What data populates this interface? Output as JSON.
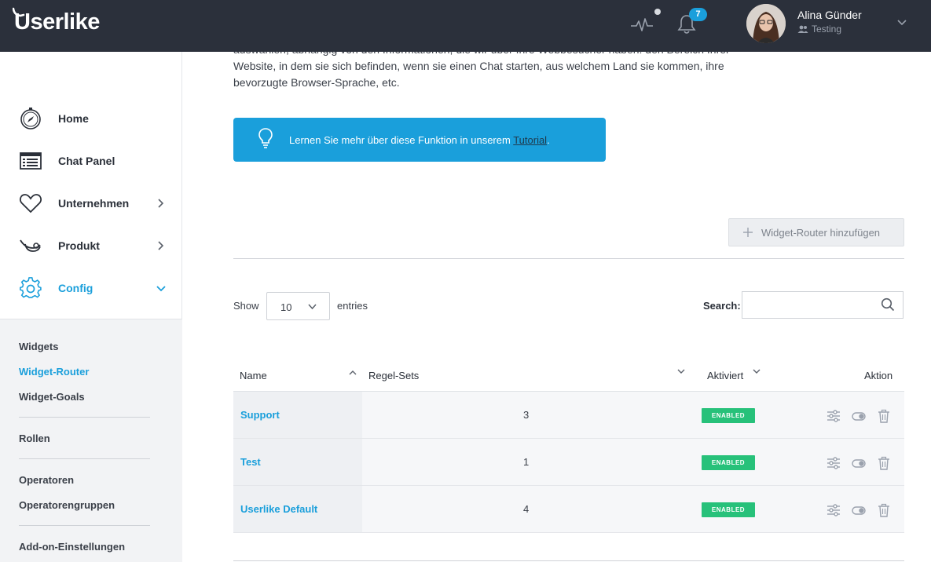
{
  "header": {
    "logo": "Userlike",
    "notifications_count": "7",
    "user_name": "Alina Günder",
    "user_role": "Testing"
  },
  "sidebar": {
    "items": [
      {
        "label": "Home",
        "icon": "compass-icon"
      },
      {
        "label": "Chat Panel",
        "icon": "chat-panel-icon"
      },
      {
        "label": "Unternehmen",
        "icon": "heart-icon"
      },
      {
        "label": "Produkt",
        "icon": "product-icon"
      },
      {
        "label": "Config",
        "icon": "gear-icon"
      }
    ],
    "subitems": [
      {
        "label": "Widgets"
      },
      {
        "label": "Widget-Router"
      },
      {
        "label": "Widget-Goals"
      },
      {
        "label": "Rollen"
      },
      {
        "label": "Operatoren"
      },
      {
        "label": "Operatorengruppen"
      },
      {
        "label": "Add-on-Einstellungen"
      }
    ],
    "accent_color": "#1a9fdb"
  },
  "main": {
    "intro_line1": "auswählen, abhängig von den Informationen, die wir über Ihre Webbesucher haben: den Bereich Ihrer",
    "intro_line2": "Website, in dem sie sich befinden, wenn sie einen Chat starten, aus welchem Land sie kommen, ihre",
    "intro_line3": "bevorzugte Browser-Sprache, etc.",
    "tip_text": "Lernen Sie mehr über diese Funktion in unserem ",
    "tip_link": "Tutorial",
    "tip_suffix": ".",
    "add_button": "Widget-Router hinzufügen",
    "show_label": "Show",
    "entries_value": "10",
    "entries_label": "entries",
    "search_label": "Search:",
    "search_value": "",
    "table": {
      "columns": [
        "Name",
        "Regel-Sets",
        "Aktiviert",
        "Aktion"
      ],
      "rows": [
        {
          "name": "Support",
          "rule_sets": "3",
          "status": "ENABLED"
        },
        {
          "name": "Test",
          "rule_sets": "1",
          "status": "ENABLED"
        },
        {
          "name": "Userlike Default",
          "rule_sets": "4",
          "status": "ENABLED"
        }
      ]
    },
    "status_color": "#27c17a"
  }
}
